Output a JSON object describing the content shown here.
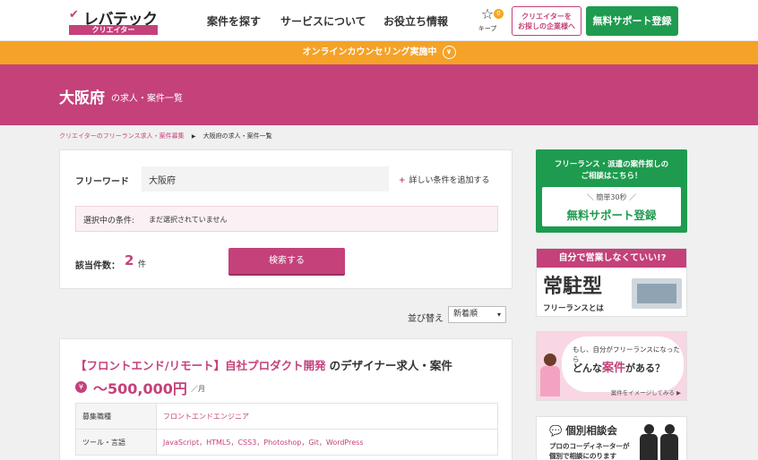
{
  "header": {
    "logo_mark": "✔",
    "logo_text": "レバテック",
    "logo_sub": "クリエイター",
    "nav": [
      "案件を探す",
      "サービスについて",
      "お役立ち情報"
    ],
    "keep_label": "キープ",
    "keep_count": "0",
    "company_button_line1": "クリエイターを",
    "company_button_line2": "お探しの企業様へ",
    "support_button": "無料サポート登録"
  },
  "banner": {
    "text": "オンラインカウンセリング実施中",
    "icon": "chevron-down-circle-icon"
  },
  "title_bar": {
    "main": "大阪府",
    "sub": "の求人・案件一覧"
  },
  "breadcrumb": {
    "link": "クリエイターのフリーランス求人・案件募集",
    "separator": "▶",
    "current": "大阪府の求人・案件一覧"
  },
  "search": {
    "freeword_label": "フリーワード",
    "freeword_value": "大阪府",
    "add_condition": "詳しい条件を追加する",
    "selected_label": "選択中の条件:",
    "selected_value": "まだ選択されていません",
    "count_label": "該当件数：",
    "count_value": "2",
    "count_unit": "件",
    "search_button": "検索する"
  },
  "sort": {
    "label": "並び替え",
    "selected": "新着順"
  },
  "job": {
    "title_highlight": "【フロントエンド/リモート】自社プロダクト開発",
    "title_rest": "のデザイナー求人・案件",
    "yen_icon": "¥",
    "salary": "〜500,000円",
    "salary_unit": "／月",
    "rows": [
      {
        "key": "募集職種",
        "value": "フロントエンドエンジニア"
      },
      {
        "key": "ツール・言語",
        "value": "JavaScript，HTML5，CSS3，Photoshop，Git，WordPress"
      }
    ]
  },
  "sidebar": {
    "support": {
      "line1": "フリーランス・派遣の案件探しの",
      "line2": "ご相談はこちら！",
      "small": "＼ 簡単30秒 ／",
      "big": "無料サポート登録"
    },
    "banner2": {
      "top": "自分で営業しなくていい!?",
      "main": "常駐型",
      "sub": "フリーランスとは"
    },
    "banner3": {
      "line1": "もし、自分がフリーランスになったら",
      "line2_a": "どんな",
      "line2_b": "案件",
      "line2_c": "がある？",
      "more": "案件をイメージしてみる ▶"
    },
    "banner4": {
      "title": "個別相談会",
      "line1": "プロのコーディネーターが",
      "line2": "個別で相談にのります"
    }
  },
  "colors": {
    "brand": "#c4417a",
    "green": "#1e9b4f",
    "orange": "#f5a228"
  }
}
